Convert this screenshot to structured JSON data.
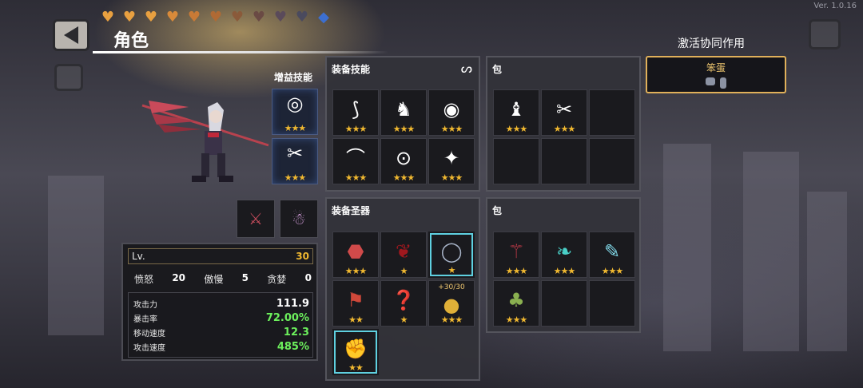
{
  "version": "Ver. 1.0.16",
  "hearts": [
    {
      "color": "#e8a040",
      "icon": "heart-icon"
    },
    {
      "color": "#e8a040",
      "icon": "heart-icon"
    },
    {
      "color": "#e8a040",
      "icon": "heart-icon"
    },
    {
      "color": "#d88a3a",
      "icon": "heart-icon"
    },
    {
      "color": "#c97a36",
      "icon": "heart-icon"
    },
    {
      "color": "#b06a34",
      "icon": "heart-icon"
    },
    {
      "color": "#8a5a3a",
      "icon": "heart-icon"
    },
    {
      "color": "#6a4a44",
      "icon": "heart-icon"
    },
    {
      "color": "#5a4a5a",
      "icon": "heart-icon"
    },
    {
      "color": "#4a4a5e",
      "icon": "heart-icon"
    },
    {
      "color": "#3c6fd0",
      "icon": "diamond-icon"
    }
  ],
  "header": {
    "title": "角色"
  },
  "synergy": {
    "title": "激活协同作用",
    "card_name": "笨蛋"
  },
  "buff": {
    "label": "增益技能",
    "items": [
      {
        "icon": "◎",
        "stars": "★★★"
      },
      {
        "icon": "✂",
        "stars": "★★★"
      }
    ]
  },
  "skills": {
    "title": "装备技能",
    "link_icon": "ᔕ",
    "items": [
      {
        "icon": "⟆",
        "stars": "★★★"
      },
      {
        "icon": "♞",
        "stars": "★★★"
      },
      {
        "icon": "◉",
        "stars": "★★★"
      },
      {
        "icon": "⌒",
        "stars": "★★★"
      },
      {
        "icon": "⊙",
        "stars": "★★★"
      },
      {
        "icon": "✦",
        "stars": "★★★"
      }
    ]
  },
  "skill_bag": {
    "title": "包",
    "items": [
      {
        "icon": "♝",
        "stars": "★★★"
      },
      {
        "icon": "✂",
        "stars": "★★★"
      }
    ]
  },
  "relics": {
    "title": "装备圣器",
    "items": [
      {
        "icon": "⬣",
        "color": "#d04a4a",
        "stars": "★★★"
      },
      {
        "icon": "❦",
        "color": "#a0181e",
        "stars": "★"
      },
      {
        "icon": "◯",
        "color": "#a8b4c8",
        "stars": "★",
        "glow": true
      },
      {
        "icon": "⚑",
        "color": "#d0483a",
        "stars": "★★"
      },
      {
        "icon": "❓",
        "color": "#9a7ad8",
        "stars": "★"
      },
      {
        "icon": "●",
        "color": "#e0b038",
        "stars": "★★★",
        "badge": "+30/30"
      },
      {
        "icon": "✊",
        "color": "#8a8a98",
        "stars": "★★",
        "glow": true
      }
    ]
  },
  "relic_bag": {
    "title": "包",
    "items": [
      {
        "icon": "⚚",
        "color": "#c03a48",
        "stars": "★★★"
      },
      {
        "icon": "❧",
        "color": "#4ad0c8",
        "stars": "★★★"
      },
      {
        "icon": "✎",
        "color": "#80d8e8",
        "stars": "★★★"
      },
      {
        "icon": "♣",
        "color": "#8ab050",
        "stars": "★★★"
      }
    ]
  },
  "equipped": [
    {
      "icon": "⚔",
      "color": "#c04a5a"
    },
    {
      "icon": "☃",
      "color": "#d8a0e0"
    }
  ],
  "stats": {
    "level_label": "Lv.",
    "level": "30",
    "sins": [
      {
        "label": "愤怒",
        "value": "20"
      },
      {
        "label": "傲慢",
        "value": "5"
      },
      {
        "label": "贪婪",
        "value": "0"
      }
    ],
    "attributes": [
      {
        "label": "攻击力",
        "value": "111.9",
        "color": "#ffffff"
      },
      {
        "label": "暴击率",
        "value": "72.00%",
        "color": "#6cef5c"
      },
      {
        "label": "移动速度",
        "value": "12.3",
        "color": "#6cef5c"
      },
      {
        "label": "攻击速度",
        "value": "485%",
        "color": "#6cef5c"
      }
    ]
  }
}
